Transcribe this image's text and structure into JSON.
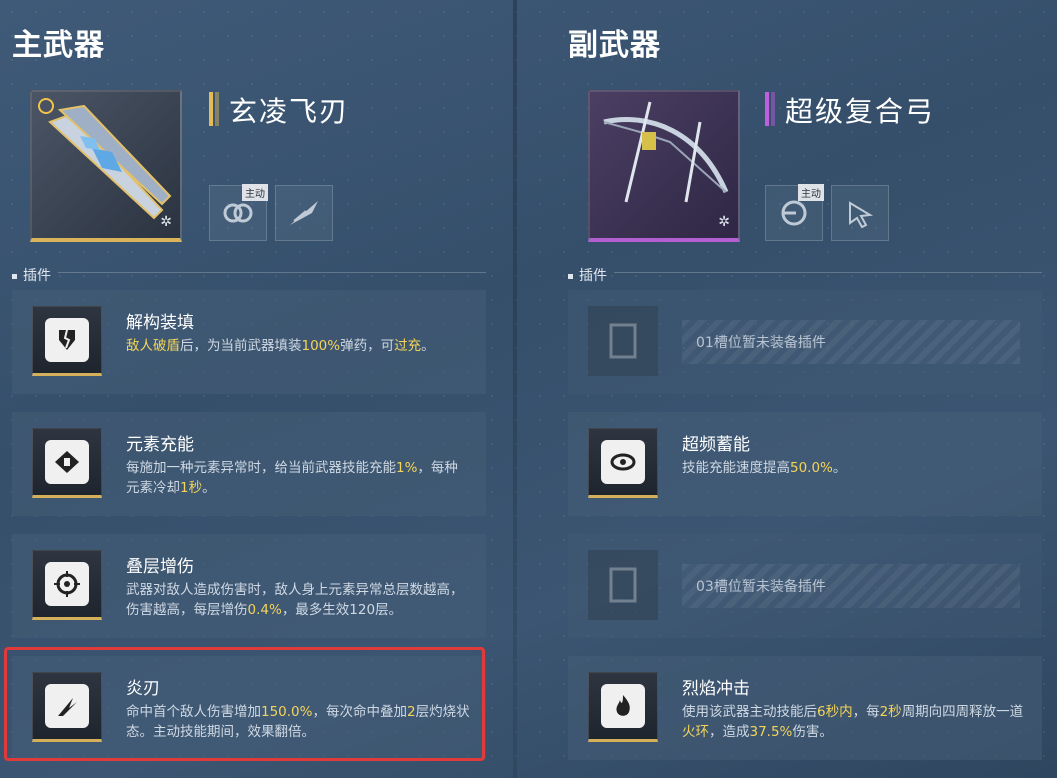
{
  "main": {
    "section_title": "主武器",
    "weapon_name": "玄凌飞刃",
    "active_tag": "主动",
    "plugins_label": "插件",
    "plugins": [
      {
        "name": "解构装填",
        "desc": [
          {
            "t": "敌人破盾",
            "h": true
          },
          {
            "t": "后，为当前武器填装",
            "h": false
          },
          {
            "t": "100%",
            "h": true
          },
          {
            "t": "弹药，可",
            "h": false
          },
          {
            "t": "过充",
            "h": true
          },
          {
            "t": "。",
            "h": false
          }
        ]
      },
      {
        "name": "元素充能",
        "desc": [
          {
            "t": "每施加一种元素异常时，给当前武器技能充能",
            "h": false
          },
          {
            "t": "1%",
            "h": true
          },
          {
            "t": "，每种元素冷却",
            "h": false
          },
          {
            "t": "1秒",
            "h": true
          },
          {
            "t": "。",
            "h": false
          }
        ]
      },
      {
        "name": "叠层增伤",
        "desc": [
          {
            "t": "武器对敌人造成伤害时，敌人身上元素异常总层数越高，伤害越高，每层增伤",
            "h": false
          },
          {
            "t": "0.4%",
            "h": true
          },
          {
            "t": "，最多生效120层。",
            "h": false
          }
        ]
      },
      {
        "name": "炎刃",
        "desc": [
          {
            "t": "命中首个敌人伤害增加",
            "h": false
          },
          {
            "t": "150.0%",
            "h": true
          },
          {
            "t": "，每次命中叠加",
            "h": false
          },
          {
            "t": "2",
            "h": true
          },
          {
            "t": "层灼烧状态。主动技能期间，效果翻倍。",
            "h": false
          }
        ]
      }
    ]
  },
  "sub": {
    "section_title": "副武器",
    "weapon_name": "超级复合弓",
    "active_tag": "主动",
    "plugins_label": "插件",
    "plugins": [
      {
        "empty": true,
        "text": "01槽位暂未装备插件"
      },
      {
        "name": "超频蓄能",
        "desc": [
          {
            "t": "技能充能速度提高",
            "h": false
          },
          {
            "t": "50.0%",
            "h": true
          },
          {
            "t": "。",
            "h": false
          }
        ]
      },
      {
        "empty": true,
        "text": "03槽位暂未装备插件"
      },
      {
        "name": "烈焰冲击",
        "desc": [
          {
            "t": "使用该武器主动技能后",
            "h": false
          },
          {
            "t": "6秒内",
            "h": true
          },
          {
            "t": "，每",
            "h": false
          },
          {
            "t": "2秒",
            "h": true
          },
          {
            "t": "周期向四周释放一道",
            "h": false
          },
          {
            "t": "火环",
            "h": true
          },
          {
            "t": "，造成",
            "h": false
          },
          {
            "t": "37.5%",
            "h": true
          },
          {
            "t": "伤害。",
            "h": false
          }
        ]
      }
    ]
  },
  "colors": {
    "highlight": "#f3d45a",
    "gold_rarity": "#e4bb55",
    "purple_rarity": "#c05ee0",
    "selection_frame": "#e03a3a"
  },
  "icons": {
    "main_weapon_skills": [
      "chain-link-icon",
      "blade-dash-icon"
    ],
    "sub_weapon_skills": [
      "target-burst-icon",
      "cursor-cycle-icon"
    ],
    "main_plugins": [
      "shattered-shield-icon",
      "element-charge-icon",
      "crosshair-stack-icon",
      "flame-blade-icon"
    ],
    "sub_plugins": [
      "empty-slot-icon",
      "spiral-eye-icon",
      "empty-slot-icon",
      "fire-icon"
    ]
  }
}
